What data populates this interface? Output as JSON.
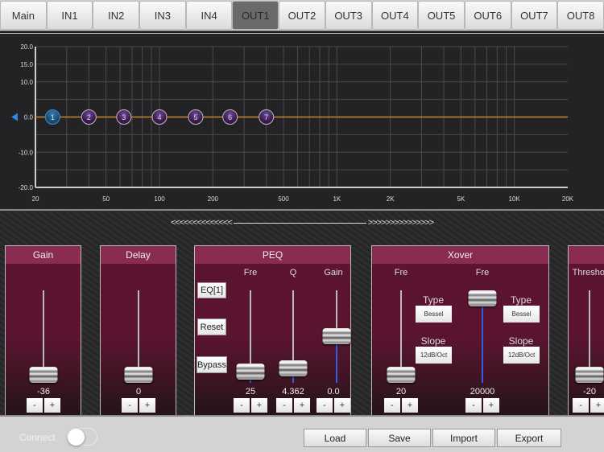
{
  "tabs": [
    "Main",
    "IN1",
    "IN2",
    "IN3",
    "IN4",
    "OUT1",
    "OUT2",
    "OUT3",
    "OUT4",
    "OUT5",
    "OUT6",
    "OUT7",
    "OUT8"
  ],
  "active_tab": "OUT1",
  "chart_data": {
    "type": "line",
    "x_scale": "log",
    "xlim": [
      20,
      20000
    ],
    "ylim": [
      -20,
      20
    ],
    "x_ticks": [
      {
        "v": 20,
        "label": "20"
      },
      {
        "v": 50,
        "label": "50"
      },
      {
        "v": 100,
        "label": "100"
      },
      {
        "v": 200,
        "label": "200"
      },
      {
        "v": 500,
        "label": "500"
      },
      {
        "v": 1000,
        "label": "1K"
      },
      {
        "v": 2000,
        "label": "2K"
      },
      {
        "v": 5000,
        "label": "5K"
      },
      {
        "v": 10000,
        "label": "10K"
      },
      {
        "v": 20000,
        "label": "20K"
      }
    ],
    "y_ticks": [
      {
        "v": 20,
        "label": "20.0"
      },
      {
        "v": 15,
        "label": "15.0"
      },
      {
        "v": 10,
        "label": "10.0"
      },
      {
        "v": 0,
        "label": "0.0"
      },
      {
        "v": -10,
        "label": "-10.0"
      },
      {
        "v": -20,
        "label": "-20.0"
      }
    ],
    "y_grid": [
      20,
      15,
      10,
      5,
      0,
      -5,
      -10,
      -15,
      -20
    ],
    "curve": {
      "color": "#c8843a",
      "points": [
        [
          20,
          0
        ],
        [
          20000,
          0
        ]
      ]
    },
    "eq_nodes": [
      {
        "label": "1",
        "freq": 25,
        "gain": 0,
        "selected": true
      },
      {
        "label": "2",
        "freq": 40,
        "gain": 0
      },
      {
        "label": "3",
        "freq": 63,
        "gain": 0
      },
      {
        "label": "4",
        "freq": 100,
        "gain": 0
      },
      {
        "label": "5",
        "freq": 160,
        "gain": 0
      },
      {
        "label": "6",
        "freq": 250,
        "gain": 0
      },
      {
        "label": "7",
        "freq": 400,
        "gain": 0
      }
    ]
  },
  "scroll_indicator": {
    "left": "<<<<<<<<<<<<<<",
    "right": ">>>>>>>>>>>>>>>"
  },
  "gain": {
    "title": "Gain",
    "value": "-36"
  },
  "delay": {
    "title": "Delay",
    "value": "0"
  },
  "peq": {
    "title": "PEQ",
    "eq_button": "EQ[1]",
    "reset_button": "Reset",
    "bypass_button": "Bypass",
    "fre_label": "Fre",
    "fre_value": "25",
    "q_label": "Q",
    "q_value": "4.362",
    "gain_label": "Gain",
    "gain_value": "0.0"
  },
  "xover": {
    "title": "Xover",
    "hp": {
      "fre_label": "Fre",
      "fre_value": "20",
      "type_label": "Type",
      "type_value": "Bessel",
      "slope_label": "Slope",
      "slope_value": "12dB/Oct"
    },
    "lp": {
      "fre_label": "Fre",
      "fre_value": "20000",
      "type_label": "Type",
      "type_value": "Bessel",
      "slope_label": "Slope",
      "slope_value": "12dB/Oct"
    }
  },
  "limiter": {
    "threshold_label": "Threshol",
    "threshold_value": "-20"
  },
  "stepper": {
    "minus": "-",
    "plus": "+"
  },
  "bottom": {
    "connect_label": "Connect",
    "connected": false,
    "load": "Load",
    "save": "Save",
    "import": "Import",
    "export": "Export"
  },
  "colors": {
    "panel_header": "#8a2b51",
    "accent_blue": "#2f5fe0",
    "curve": "#c8843a"
  }
}
